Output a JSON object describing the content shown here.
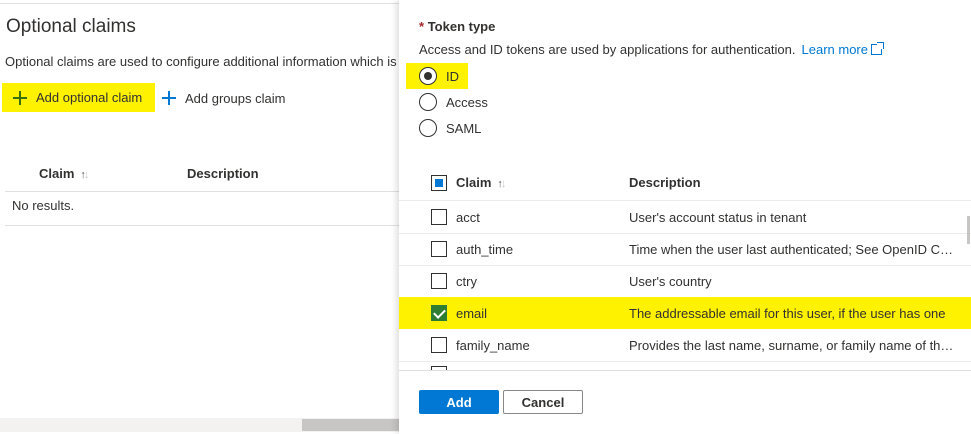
{
  "left": {
    "title": "Optional claims",
    "description": "Optional claims are used to configure additional information which is",
    "add_optional_claim": "Add optional claim",
    "add_groups_claim": "Add groups claim",
    "columns": {
      "claim": "Claim",
      "description": "Description"
    },
    "empty_text": "No results."
  },
  "panel": {
    "token_type_label": "Token type",
    "required_marker": "*",
    "token_type_desc": "Access and ID tokens are used by applications for authentication.",
    "learn_more": "Learn more",
    "token_options": [
      {
        "label": "ID",
        "selected": true
      },
      {
        "label": "Access",
        "selected": false
      },
      {
        "label": "SAML",
        "selected": false
      }
    ],
    "columns": {
      "claim": "Claim",
      "description": "Description"
    },
    "rows": [
      {
        "claim": "acct",
        "description": "User's account status in tenant",
        "checked": false
      },
      {
        "claim": "auth_time",
        "description": "Time when the user last authenticated; See OpenID Con...",
        "checked": false
      },
      {
        "claim": "ctry",
        "description": "User's country",
        "checked": false
      },
      {
        "claim": "email",
        "description": "The addressable email for this user, if the user has one",
        "checked": true
      },
      {
        "claim": "family_name",
        "description": "Provides the last name, surname, or family name of the ...",
        "checked": false
      }
    ],
    "add_button": "Add",
    "cancel_button": "Cancel"
  },
  "colors": {
    "accent": "#0078d4",
    "highlight": "#fff200",
    "checked_green": "#2e7d32"
  }
}
